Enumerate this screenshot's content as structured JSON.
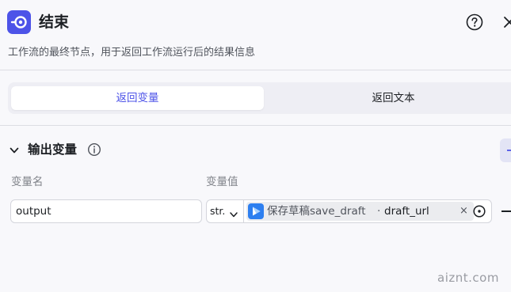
{
  "header": {
    "icon": "end-node-icon",
    "title": "结束",
    "help_icon": "help-circle-icon",
    "close_icon": "close-icon",
    "description": "工作流的最终节点，用于返回工作流运行后的结果信息"
  },
  "return_mode": {
    "tabs": [
      {
        "label": "返回变量",
        "active": true
      },
      {
        "label": "返回文本",
        "active": false
      }
    ]
  },
  "output_section": {
    "title": "输出变量",
    "info_icon": "info-icon",
    "add_icon": "plus-icon",
    "columns": {
      "name": "变量名",
      "value": "变量值"
    },
    "rows": [
      {
        "name": "output",
        "type": "str.",
        "reference": {
          "node_icon": "video-play-icon",
          "node": "保存草稿save_draft",
          "separator": "·",
          "variable": "draft_url",
          "clear_label": "×"
        }
      }
    ]
  },
  "colors": {
    "accent": "#4d53e8",
    "node_icon_bg": "#4d53e8",
    "ref_icon_bg": "#2d7ff0"
  },
  "watermark": "aiznt.com"
}
